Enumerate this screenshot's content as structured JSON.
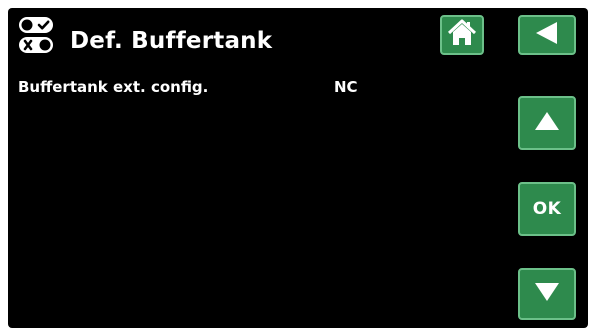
{
  "header": {
    "title": "Def. Buffertank",
    "icon": "toggle-switches-icon",
    "home_icon": "home-icon",
    "back_icon": "back-arrow-icon"
  },
  "settings": [
    {
      "label": "Buffertank ext. config.",
      "value": "NC"
    }
  ],
  "navigation": {
    "up_icon": "up-arrow-icon",
    "ok_label": "OK",
    "down_icon": "down-arrow-icon"
  },
  "colors": {
    "background": "#000000",
    "button": "#2e8a4d",
    "button_border": "#6cc089",
    "text": "#ffffff"
  }
}
